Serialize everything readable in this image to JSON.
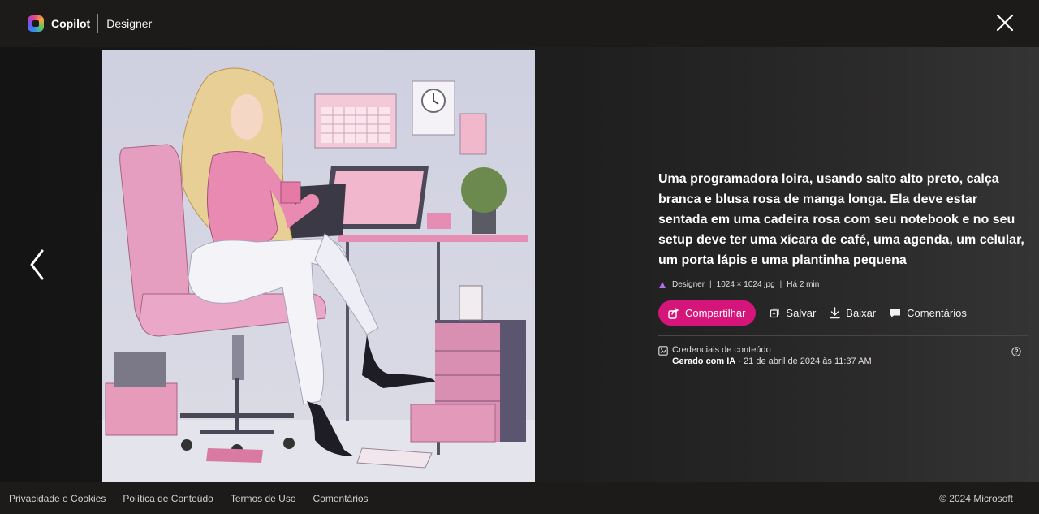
{
  "header": {
    "brand": "Copilot",
    "product": "Designer"
  },
  "image": {
    "alt": "Ilustração de uma programadora loira sentada em uma cadeira rosa com notebook"
  },
  "details": {
    "prompt": "Uma programadora loira, usando salto alto preto, calça branca e blusa rosa de manga longa. Ela deve estar sentada em uma cadeira rosa com seu notebook e no seu setup deve ter uma xícara de café, uma agenda, um celular, um porta lápis e uma plantinha pequena",
    "meta": {
      "source": "Designer",
      "dimensions": "1024 × 1024 jpg",
      "time": "Há 2 min"
    },
    "actions": {
      "share": "Compartilhar",
      "save": "Salvar",
      "download": "Baixar",
      "comments": "Comentários"
    },
    "credentials": {
      "title": "Credenciais de conteúdo",
      "generated": "Gerado com IA",
      "date": "· 21 de abril de 2024 às 11:37 AM"
    }
  },
  "footer": {
    "links": [
      "Privacidade e Cookies",
      "Política de Conteúdo",
      "Termos de Uso",
      "Comentários"
    ],
    "copyright": "© 2024 Microsoft"
  },
  "colors": {
    "accent": "#d6157a",
    "background": "#1b1a19"
  },
  "icons": [
    "copilot-logo",
    "close-icon",
    "chevron-left-icon",
    "designer-icon",
    "share-icon",
    "save-icon",
    "download-icon",
    "comment-icon",
    "credentials-icon",
    "help-icon"
  ]
}
